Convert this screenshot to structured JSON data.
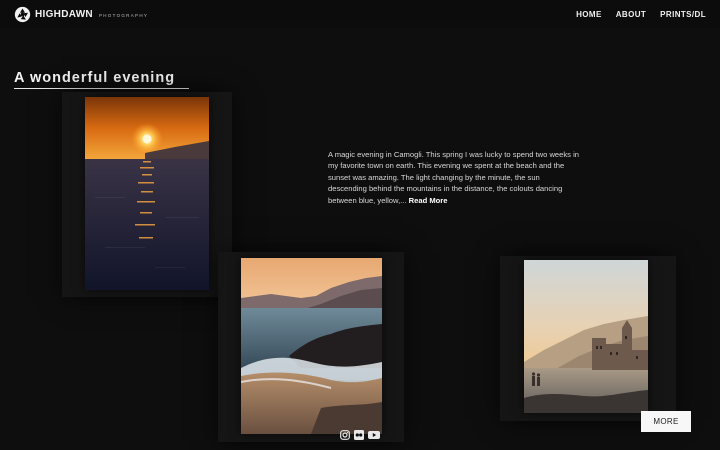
{
  "header": {
    "brand": "HIGHDAWN",
    "brand_sub": "PHOTOGRAPHY",
    "nav": [
      {
        "label": "HOME"
      },
      {
        "label": "ABOUT"
      },
      {
        "label": "PRINTS/DL"
      }
    ]
  },
  "post": {
    "title": "A wonderful evening",
    "description": "A magic evening in Camogli. This spring I was lucky to spend two weeks in my favorite town on earth. This evening we spent at the beach and the sunset was amazing. The light changing by the minute, the sun descending behind the mountains in the distance, the colouts dancing between blue, yellow,...",
    "read_more": "Read More"
  },
  "more_button": "MORE",
  "social": [
    {
      "icon": "instagram-icon"
    },
    {
      "icon": "flickr-icon"
    },
    {
      "icon": "youtube-icon"
    }
  ],
  "colors": {
    "background": "#0e0e0e",
    "text": "#e6e6e6",
    "button_bg": "#f7f7f7"
  }
}
